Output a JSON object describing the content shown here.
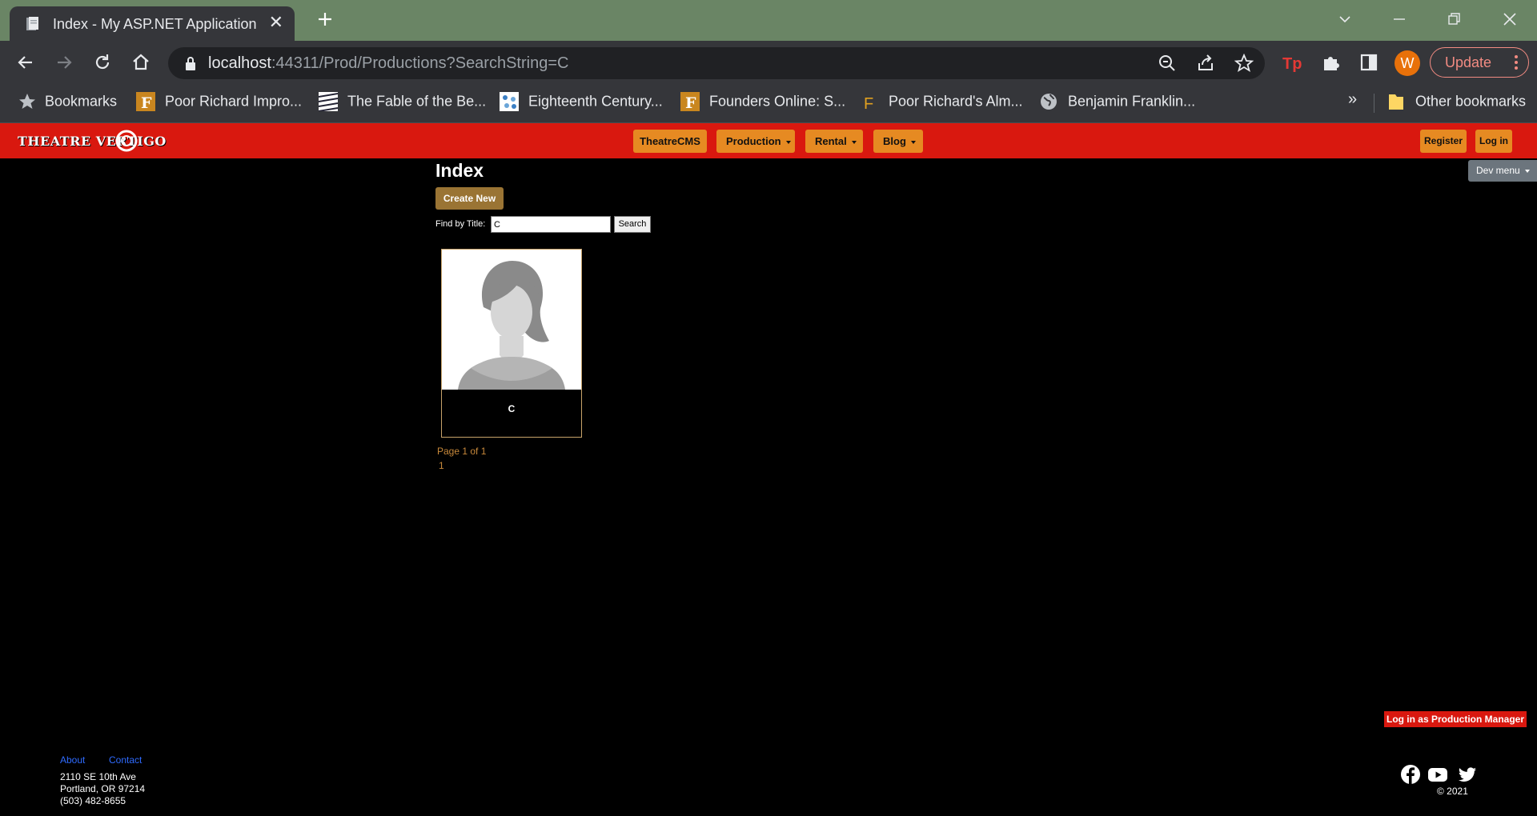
{
  "browser": {
    "tab_title": "Index - My ASP.NET Application",
    "url_host": "localhost",
    "url_rest": ":44311/Prod/Productions?SearchString=C",
    "profile_initial": "W",
    "update_label": "Update",
    "bookmarks": [
      {
        "label": "Bookmarks",
        "icon": "star-icon"
      },
      {
        "label": "Poor Richard Impro...",
        "icon": "f-favicon"
      },
      {
        "label": "The Fable of the Be...",
        "icon": "striped-favicon"
      },
      {
        "label": "Eighteenth Century...",
        "icon": "pattern-favicon"
      },
      {
        "label": "Founders Online: S...",
        "icon": "f-favicon"
      },
      {
        "label": "Poor Richard's Alm...",
        "icon": "f-letter-favicon"
      },
      {
        "label": "Benjamin Franklin...",
        "icon": "globe-icon"
      }
    ],
    "overflow_label": "»",
    "other_bookmarks": "Other bookmarks"
  },
  "site": {
    "logo_text": "THEATRE VERTIGO",
    "nav": [
      {
        "label": "TheatreCMS",
        "dropdown": false
      },
      {
        "label": "Production",
        "dropdown": true
      },
      {
        "label": "Rental",
        "dropdown": true
      },
      {
        "label": "Blog",
        "dropdown": true
      }
    ],
    "register_label": "Register",
    "login_label": "Log in",
    "dev_menu_label": "Dev menu"
  },
  "main": {
    "title": "Index",
    "create_new_label": "Create New",
    "find_label": "Find by Title:",
    "search_value": "C",
    "search_button": "Search",
    "cards": [
      {
        "title": "C"
      }
    ],
    "page_info": "Page 1 of 1",
    "page_number": "1"
  },
  "login_pm_label": "Log in as Production Manager",
  "footer": {
    "about": "About",
    "contact": "Contact",
    "address1": "2110 SE 10th Ave",
    "address2": "Portland, OR 97214",
    "phone": "(503) 482-8655",
    "copyright": "© 2021",
    "social_icons": [
      "facebook-icon",
      "youtube-icon",
      "twitter-icon"
    ]
  },
  "colors": {
    "nav_red": "#d9180f",
    "nav_button": "#e68a22",
    "create_button": "#9a7434",
    "page_text": "#c8893b",
    "link_blue": "#2f6bff"
  }
}
